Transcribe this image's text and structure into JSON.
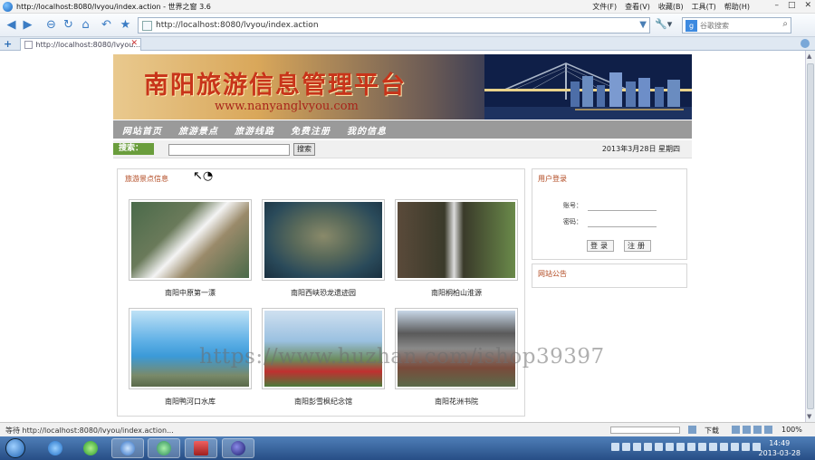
{
  "window": {
    "title": "http://localhost:8080/lvyou/index.action - 世界之窗 3.6",
    "menus": [
      "文件(F)",
      "查看(V)",
      "收藏(B)",
      "工具(T)",
      "帮助(H)"
    ],
    "controls": [
      "–",
      "□",
      "✕"
    ]
  },
  "toolbar": {
    "address": "http://localhost:8080/lvyou/index.action",
    "search_placeholder": "谷歌搜索",
    "search_engine": "g"
  },
  "tabs": [
    {
      "label": "http://localhost:8080/lvyou...",
      "active": true
    }
  ],
  "site": {
    "banner_title": "南阳旅游信息管理平台",
    "banner_url": "www.nanyanglvyou.com",
    "nav": [
      "网站首页",
      "旅游景点",
      "旅游线路",
      "免费注册",
      "我的信息"
    ],
    "search_label": "搜索：",
    "search_button": "搜索",
    "date": "2013年3月28日 星期四"
  },
  "spots_panel": {
    "title": "旅游景点信息",
    "items": [
      {
        "name": "南阳中原第一漂",
        "colors": [
          "#4a6a4a",
          "#f4f4f4"
        ]
      },
      {
        "name": "南阳西峡恐龙遗迹园",
        "colors": [
          "#2a4a5a",
          "#7a7a5a"
        ]
      },
      {
        "name": "南阳桐柏山淮源",
        "colors": [
          "#3a3a2a",
          "#6a8a4a"
        ]
      },
      {
        "name": "南阳鸭河口水库",
        "colors": [
          "#3b9ad8",
          "#c8e8f4"
        ]
      },
      {
        "name": "南阳彭雪枫纪念馆",
        "colors": [
          "#9ac0e0",
          "#4a7a3a"
        ]
      },
      {
        "name": "南阳花洲书院",
        "colors": [
          "#c8d8e8",
          "#5a5a5a"
        ]
      }
    ]
  },
  "login_panel": {
    "title": "用户登录",
    "account_label": "账号：",
    "password_label": "密码：",
    "login_button": "登录",
    "register_button": "注册"
  },
  "notice_panel": {
    "title": "网站公告"
  },
  "watermark": "https://www.huzhan.com/ishop39397",
  "statusbar": {
    "status": "等待 http://localhost:8080/lvyou/index.action...",
    "download": "下载",
    "zoom": "100%"
  },
  "taskbar": {
    "time": "14:49",
    "date": "2013-03-28"
  },
  "colors": {
    "nav_bg": "#9a9a9a",
    "panel_title": "#b24a22",
    "search_label_bg": "#6a9d3c",
    "banner_title": "#c8341a"
  }
}
